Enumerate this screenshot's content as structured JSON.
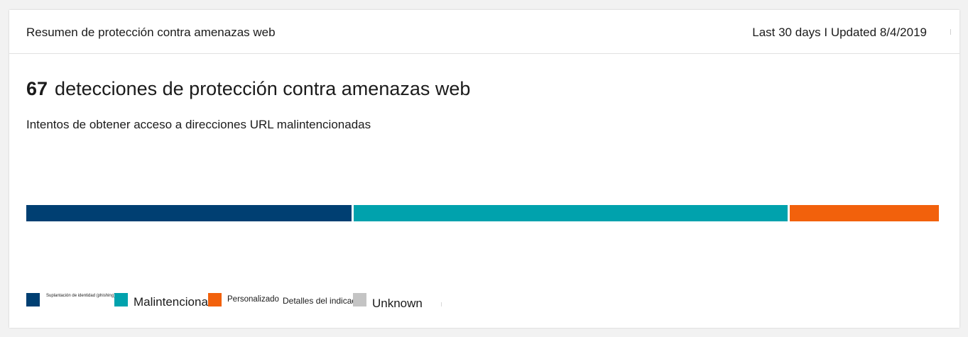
{
  "card": {
    "title": "Resumen de protección contra amenazas web",
    "meta": "Last 30 days I Updated 8/4/2019"
  },
  "summary": {
    "count": "67",
    "headline": "detecciones de protección contra amenazas web",
    "subtitle": "Intentos de obtener acceso a direcciones URL malintencionadas"
  },
  "chart_data": {
    "type": "bar",
    "orientation": "horizontal-stacked",
    "categories": [
      "Suplantación de identidad (phishing)",
      "Malintencionado",
      "Personalizado",
      "Unknown"
    ],
    "values": [
      24,
      32,
      11,
      0
    ],
    "colors": [
      "#003f72",
      "#00a2ad",
      "#f2610c",
      "#c4c4c4"
    ]
  },
  "legend": {
    "items": [
      {
        "label": "Suplantación de identidad (phishing)",
        "color": "#003f72"
      },
      {
        "label": "Malintencionado",
        "color": "#00a2ad"
      },
      {
        "label": "Personalizado",
        "color": "#f2610c"
      },
      {
        "label": "Detalles del indicador",
        "color": ""
      },
      {
        "label": "Unknown",
        "color": "#c4c4c4"
      }
    ]
  }
}
